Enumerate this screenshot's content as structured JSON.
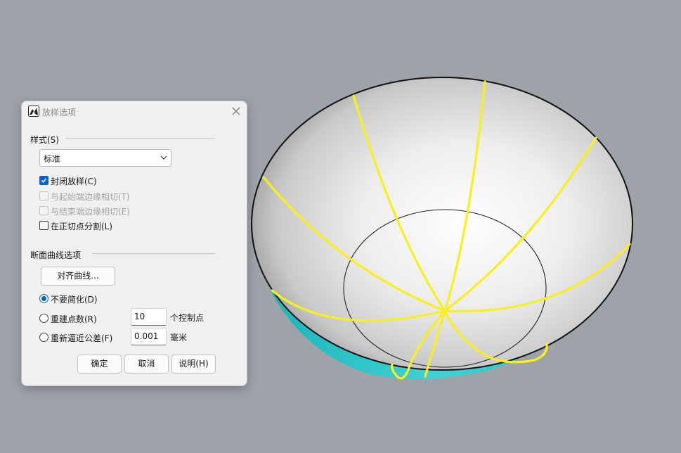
{
  "dialog": {
    "title": "放样选项",
    "style_section": {
      "label": "样式(S)",
      "select_value": "标准"
    },
    "checkboxes": [
      {
        "label": "封闭放样(C)",
        "checked": true,
        "enabled": true
      },
      {
        "label": "与起始端边缘相切(T)",
        "checked": false,
        "enabled": false
      },
      {
        "label": "与结束端边缘相切(E)",
        "checked": false,
        "enabled": false
      },
      {
        "label": "在正切点分割(L)",
        "checked": false,
        "enabled": true
      }
    ],
    "section_curve": {
      "label": "断面曲线选项",
      "align_button": "对齐曲线...",
      "radios": [
        {
          "label": "不要简化(D)",
          "selected": true
        },
        {
          "label": "重建点数(R)",
          "selected": false,
          "value": "10",
          "unit": "个控制点"
        },
        {
          "label": "重新逼近公差(F)",
          "selected": false,
          "value": "0.001",
          "unit": "毫米"
        }
      ]
    },
    "buttons": {
      "ok": "确定",
      "cancel": "取消",
      "help": "说明(H)"
    }
  },
  "viewport": {
    "background_color": "#9ea3aa",
    "surface_color": "#f2f2f2",
    "outer_color": "#35c9cc",
    "curve_color": "#f7f01e"
  }
}
